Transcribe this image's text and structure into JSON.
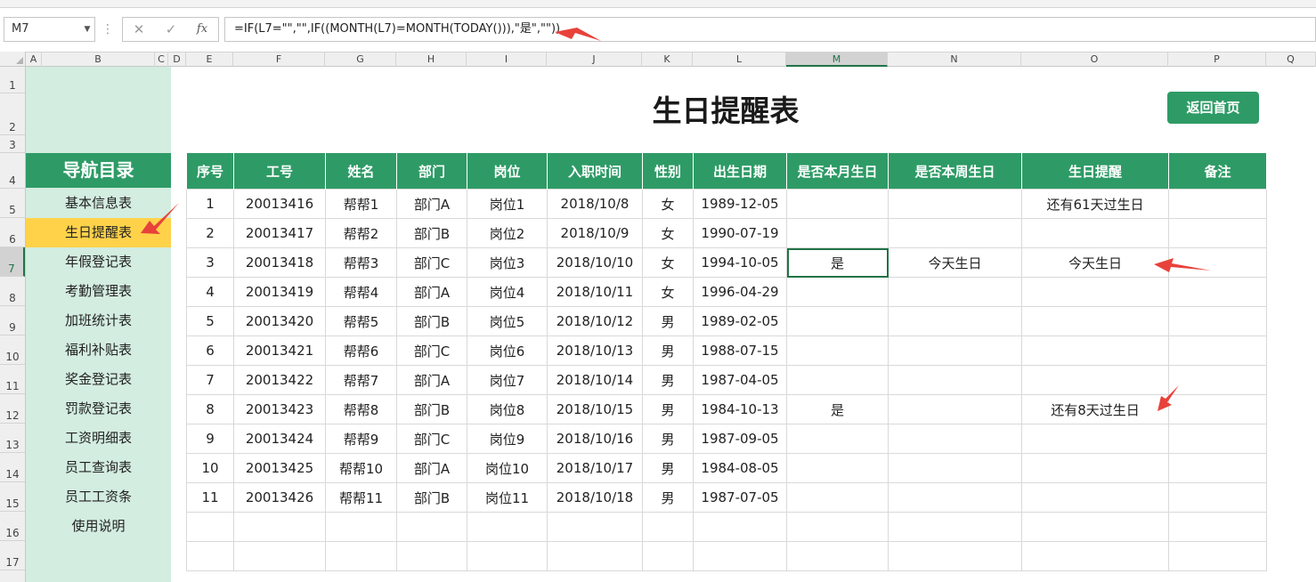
{
  "formula_bar": {
    "name_box": "M7",
    "cancel_icon": "✕",
    "enter_icon": "✓",
    "fx_icon": "fx",
    "formula": "=IF(L7=\"\",\"\",IF((MONTH(L7)=MONTH(TODAY())),\"是\",\"\"))"
  },
  "columns": [
    "A",
    "B",
    "C",
    "D",
    "E",
    "F",
    "G",
    "H",
    "I",
    "J",
    "K",
    "L",
    "M",
    "N",
    "O",
    "P",
    "Q"
  ],
  "active_column": "M",
  "rows": [
    "1",
    "2",
    "3",
    "4",
    "5",
    "6",
    "7",
    "8",
    "9",
    "10",
    "11",
    "12",
    "13",
    "14",
    "15",
    "16",
    "17"
  ],
  "active_row": "7",
  "nav": {
    "title": "导航目录",
    "items": [
      {
        "label": "基本信息表"
      },
      {
        "label": "生日提醒表"
      },
      {
        "label": "年假登记表"
      },
      {
        "label": "考勤管理表"
      },
      {
        "label": "加班统计表"
      },
      {
        "label": "福利补贴表"
      },
      {
        "label": "奖金登记表"
      },
      {
        "label": "罚款登记表"
      },
      {
        "label": "工资明细表"
      },
      {
        "label": "员工查询表"
      },
      {
        "label": "员工工资条"
      },
      {
        "label": "使用说明"
      }
    ],
    "active_index": 1
  },
  "sheet": {
    "title": "生日提醒表",
    "home_button": "返回首页"
  },
  "table": {
    "headers": [
      "序号",
      "工号",
      "姓名",
      "部门",
      "岗位",
      "入职时间",
      "性别",
      "出生日期",
      "是否本月生日",
      "是否本周生日",
      "生日提醒",
      "备注"
    ],
    "rows": [
      [
        "1",
        "20013416",
        "帮帮1",
        "部门A",
        "岗位1",
        "2018/10/8",
        "女",
        "1989-12-05",
        "",
        "",
        "还有61天过生日",
        ""
      ],
      [
        "2",
        "20013417",
        "帮帮2",
        "部门B",
        "岗位2",
        "2018/10/9",
        "女",
        "1990-07-19",
        "",
        "",
        "",
        ""
      ],
      [
        "3",
        "20013418",
        "帮帮3",
        "部门C",
        "岗位3",
        "2018/10/10",
        "女",
        "1994-10-05",
        "是",
        "今天生日",
        "今天生日",
        ""
      ],
      [
        "4",
        "20013419",
        "帮帮4",
        "部门A",
        "岗位4",
        "2018/10/11",
        "女",
        "1996-04-29",
        "",
        "",
        "",
        ""
      ],
      [
        "5",
        "20013420",
        "帮帮5",
        "部门B",
        "岗位5",
        "2018/10/12",
        "男",
        "1989-02-05",
        "",
        "",
        "",
        ""
      ],
      [
        "6",
        "20013421",
        "帮帮6",
        "部门C",
        "岗位6",
        "2018/10/13",
        "男",
        "1988-07-15",
        "",
        "",
        "",
        ""
      ],
      [
        "7",
        "20013422",
        "帮帮7",
        "部门A",
        "岗位7",
        "2018/10/14",
        "男",
        "1987-04-05",
        "",
        "",
        "",
        ""
      ],
      [
        "8",
        "20013423",
        "帮帮8",
        "部门B",
        "岗位8",
        "2018/10/15",
        "男",
        "1984-10-13",
        "是",
        "",
        "还有8天过生日",
        ""
      ],
      [
        "9",
        "20013424",
        "帮帮9",
        "部门C",
        "岗位9",
        "2018/10/16",
        "男",
        "1987-09-05",
        "",
        "",
        "",
        ""
      ],
      [
        "10",
        "20013425",
        "帮帮10",
        "部门A",
        "岗位10",
        "2018/10/17",
        "男",
        "1984-08-05",
        "",
        "",
        "",
        ""
      ],
      [
        "11",
        "20013426",
        "帮帮11",
        "部门B",
        "岗位11",
        "2018/10/18",
        "男",
        "1987-07-05",
        "",
        "",
        "",
        ""
      ],
      [
        "",
        "",
        "",
        "",
        "",
        "",
        "",
        "",
        "",
        "",
        "",
        ""
      ],
      [
        "",
        "",
        "",
        "",
        "",
        "",
        "",
        "",
        "",
        "",
        "",
        ""
      ]
    ],
    "active_cell": {
      "row": 2,
      "col": 8
    }
  },
  "colors": {
    "header_green": "#2e9b66",
    "nav_bg": "#d3ede0",
    "nav_active": "#ffd24a",
    "annotation_arrow": "#e8423b"
  }
}
